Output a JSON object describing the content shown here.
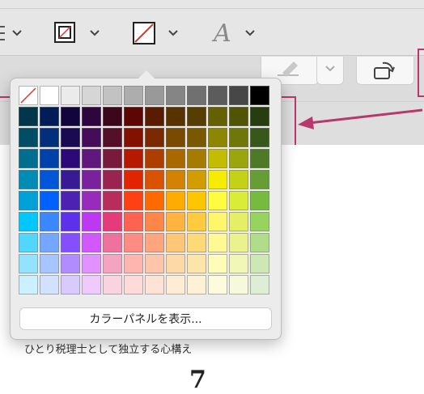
{
  "toolbar": {
    "controls": [
      {
        "name": "list-style-icon"
      },
      {
        "name": "border-style-icon"
      },
      {
        "name": "fill-none-icon"
      },
      {
        "name": "font-icon",
        "glyph": "A"
      }
    ]
  },
  "palette": {
    "panel_button_label": "カラーパネルを表示...",
    "rows": [
      [
        "none",
        "#ffffff",
        "#ebebeb",
        "#d6d6d6",
        "#c2c2c2",
        "#adadad",
        "#999999",
        "#858585",
        "#707070",
        "#5c5c5c",
        "#474747",
        "#000000"
      ],
      [
        "#00374a",
        "#011d57",
        "#11053b",
        "#2e063d",
        "#3c071b",
        "#5c0701",
        "#5a1c00",
        "#583300",
        "#563d00",
        "#666100",
        "#4f5504",
        "#263e0f"
      ],
      [
        "#004d65",
        "#012f7b",
        "#1a0a52",
        "#450d59",
        "#551029",
        "#831100",
        "#7b2900",
        "#7a4a00",
        "#785800",
        "#8d8602",
        "#6f760a",
        "#38571a"
      ],
      [
        "#016e8f",
        "#0042a9",
        "#2c0977",
        "#61187c",
        "#791a3d",
        "#b51a00",
        "#ad3e00",
        "#a96800",
        "#a67b01",
        "#c4bc00",
        "#9ba50e",
        "#4e7a27"
      ],
      [
        "#008cb4",
        "#0056d6",
        "#371a94",
        "#7a219e",
        "#99244f",
        "#e22400",
        "#da5100",
        "#d38301",
        "#d19d01",
        "#f5ec00",
        "#c3d117",
        "#669d34"
      ],
      [
        "#00a1d8",
        "#0061fe",
        "#4d22b2",
        "#982abc",
        "#b92d5d",
        "#ff4015",
        "#ff6a00",
        "#ffab01",
        "#fcc700",
        "#fefb41",
        "#d9ec37",
        "#76bb40"
      ],
      [
        "#01c7fc",
        "#3a87fe",
        "#5e30eb",
        "#be38f3",
        "#e63b7a",
        "#fe6250",
        "#fe8648",
        "#feb43f",
        "#fecb3e",
        "#fff76b",
        "#e4ef65",
        "#96d35f"
      ],
      [
        "#52d6fc",
        "#74a7ff",
        "#864ffe",
        "#d357fe",
        "#ee719e",
        "#ff8c82",
        "#fea57d",
        "#fec777",
        "#fed977",
        "#fff994",
        "#eaf28f",
        "#b1dd8b"
      ],
      [
        "#93e3fc",
        "#a7c6ff",
        "#b18cfe",
        "#e292fe",
        "#f4a4c0",
        "#ffb5af",
        "#ffc5ab",
        "#fed9a8",
        "#fde4a8",
        "#fffbb9",
        "#f1f7b7",
        "#cde8b5"
      ],
      [
        "#cbf0ff",
        "#d2e2fe",
        "#d8c9fe",
        "#efcafe",
        "#f9d3e0",
        "#ffdad8",
        "#ffe2d6",
        "#feecd4",
        "#fef1d5",
        "#fdfbdd",
        "#f6fadb",
        "#deeed4"
      ]
    ]
  },
  "document": {
    "caption": "ひとり税理士として独立する心構え",
    "big_number": "7"
  },
  "accent_color": "#b8386b"
}
